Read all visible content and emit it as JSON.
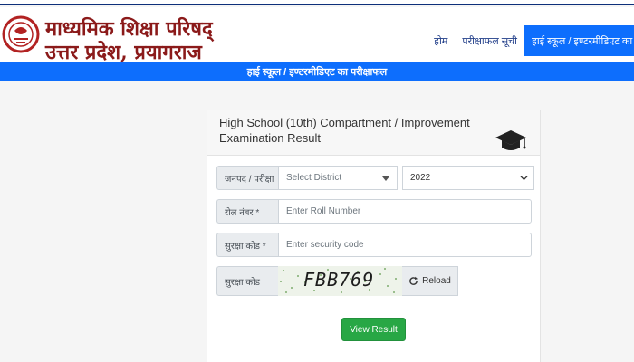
{
  "header": {
    "org_line1": "माध्यमिक शिक्षा परिषद्",
    "org_line2": "उत्तर प्रदेश, प्रयागराज"
  },
  "nav": {
    "items": [
      {
        "label": "होम"
      },
      {
        "label": "परीक्षाफल सूची"
      },
      {
        "label": "हाई स्कूल / इण्टरमीडिएट का प"
      }
    ]
  },
  "banner": {
    "text": "हाई स्कूल / इण्टरमीडिएट का परीक्षाफल"
  },
  "form": {
    "title": "High School (10th) Compartment / Improvement Examination Result",
    "district_label": "जनपद / परीक्षा",
    "district_selected": "Select District",
    "year_selected": "2022",
    "roll_label": "रोल नंबर *",
    "roll_placeholder": "Enter Roll Number",
    "security_label": "सुरक्षा कोड *",
    "security_placeholder": "Enter security code",
    "captcha_label": "सुरक्षा कोड",
    "captcha_text": "FBB769",
    "reload_label": "Reload",
    "submit_label": "View Result"
  },
  "colors": {
    "primary": "#0d6efd",
    "brand": "#8b1a1a",
    "success": "#28a745"
  }
}
